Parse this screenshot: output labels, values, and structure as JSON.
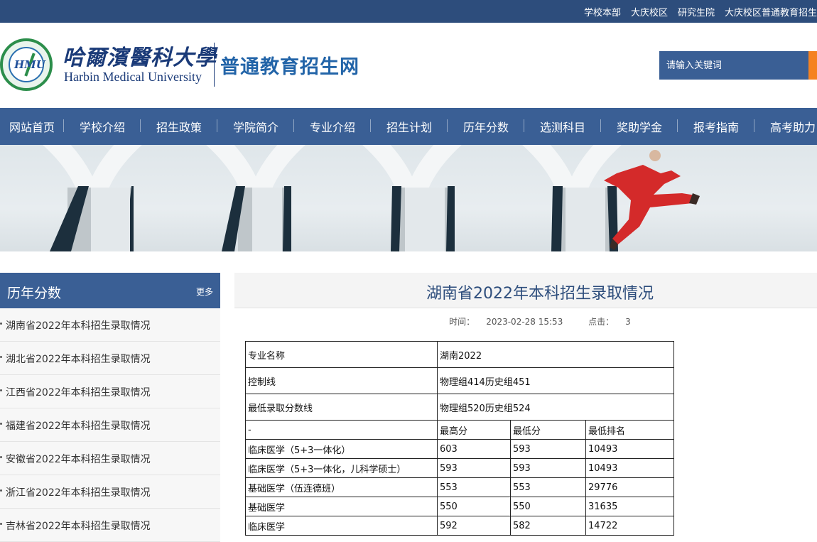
{
  "topbar": {
    "links": [
      "学校本部",
      "大庆校区",
      "研究生院",
      "大庆校区普通教育招生"
    ]
  },
  "header": {
    "school_cn": "哈爾濱醫科大學",
    "school_en": "Harbin Medical University",
    "logo_text": "HMU",
    "site_title": "普通教育招生网"
  },
  "search": {
    "placeholder": "请输入关键词"
  },
  "nav": {
    "items": [
      "网站首页",
      "学校介绍",
      "招生政策",
      "学院简介",
      "专业介绍",
      "招生计划",
      "历年分数",
      "选测科目",
      "奖助学金",
      "报考指南",
      "高考助力"
    ]
  },
  "sidebar": {
    "title": "历年分数",
    "more": "更多",
    "items": [
      "湖南省2022年本科招生录取情况",
      "湖北省2022年本科招生录取情况",
      "江西省2022年本科招生录取情况",
      "福建省2022年本科招生录取情况",
      "安徽省2022年本科招生录取情况",
      "浙江省2022年本科招生录取情况",
      "吉林省2022年本科招生录取情况"
    ]
  },
  "article": {
    "title": "湖南省2022年本科招生录取情况",
    "time_label": "时间：",
    "time": "2023-02-28 15:53",
    "clicks_label": "点击：",
    "clicks": "3"
  },
  "table": {
    "info_rows": [
      {
        "label": "专业名称",
        "value": "湖南2022"
      },
      {
        "label": "控制线",
        "value": "物理组414历史组451"
      },
      {
        "label": "最低录取分数线",
        "value": "物理组520历史组524"
      }
    ],
    "headers": [
      "-",
      "最高分",
      "最低分",
      "最低排名"
    ],
    "rows": [
      [
        "临床医学（5+3一体化）",
        "603",
        "593",
        "10493"
      ],
      [
        "临床医学（5+3一体化，儿科学硕士）",
        "593",
        "593",
        "10493"
      ],
      [
        "基础医学（伍连德班）",
        "553",
        "553",
        "29776"
      ],
      [
        "基础医学",
        "550",
        "550",
        "31635"
      ],
      [
        "临床医学",
        "592",
        "582",
        "14722"
      ]
    ]
  },
  "colors": {
    "primary": "#3a5f95",
    "topbar": "#2d4d7c",
    "accent": "#f58220",
    "title_blue": "#2264a8"
  }
}
